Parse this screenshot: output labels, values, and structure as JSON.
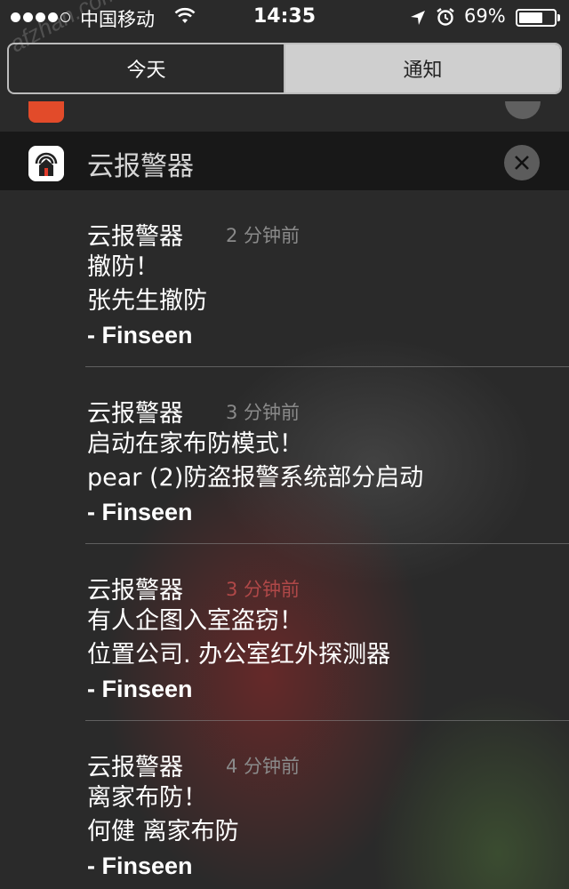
{
  "status_bar": {
    "carrier": "中国移动",
    "time": "14:35",
    "battery_percent": "69%",
    "battery_level": 0.69,
    "signal_bars_filled": 4,
    "signal_bars_total": 5
  },
  "watermark": "afzhan.com",
  "tabs": {
    "today": "今天",
    "notifications": "通知",
    "selected": "notifications"
  },
  "group": {
    "app_name": "云报警器",
    "icon": "alarm-house-icon",
    "close_icon": "close-icon"
  },
  "notifications": [
    {
      "app": "云报警器",
      "time": "2 分钟前",
      "title": "撤防！",
      "body": "张先生撤防",
      "signature": "- Finseen",
      "time_alert": false
    },
    {
      "app": "云报警器",
      "time": "3 分钟前",
      "title": "启动在家布防模式！",
      "body": "pear (2)防盗报警系统部分启动",
      "signature": "- Finseen",
      "time_alert": false
    },
    {
      "app": "云报警器",
      "time": "3 分钟前",
      "title": "有人企图入室盗窃！",
      "body": "位置公司. 办公室红外探测器",
      "signature": "- Finseen",
      "time_alert": true
    },
    {
      "app": "云报警器",
      "time": "4 分钟前",
      "title": "离家布防！",
      "body": "何健 离家布防",
      "signature": "- Finseen",
      "time_alert": false
    }
  ],
  "colors": {
    "time_alert": "#b04848",
    "time_normal": "#8a8a8a",
    "selected_tab_bg": "#cfcfcf"
  }
}
